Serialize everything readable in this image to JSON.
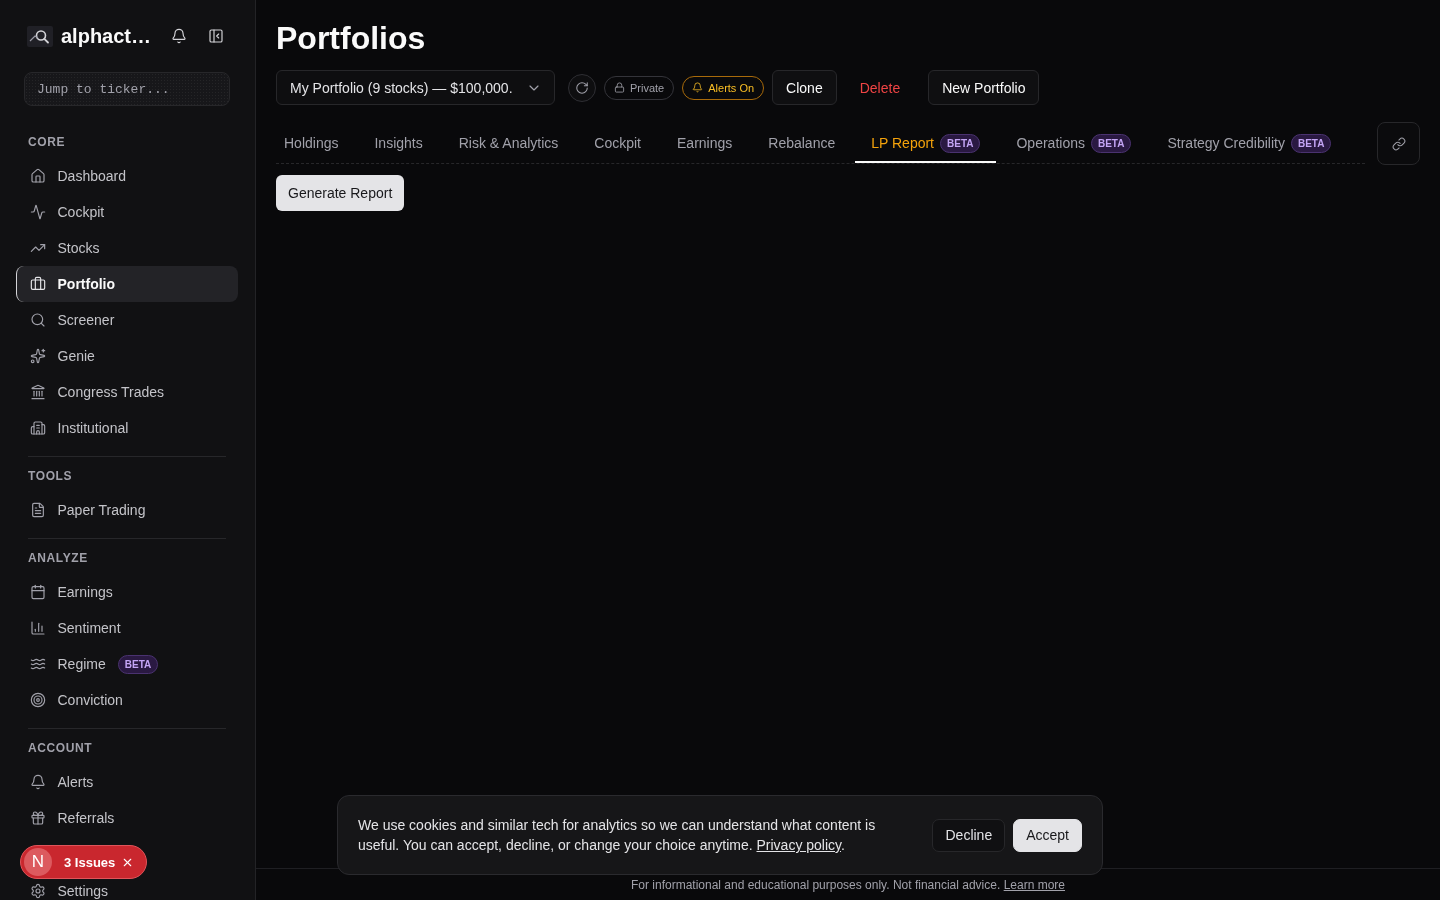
{
  "sidebar": {
    "brand": "alphact…",
    "search": {
      "placeholder": "Jump to ticker..."
    },
    "sections": [
      {
        "title": "CORE",
        "items": [
          {
            "label": "Dashboard",
            "selected": false
          },
          {
            "label": "Cockpit",
            "selected": false
          },
          {
            "label": "Stocks",
            "selected": false
          },
          {
            "label": "Portfolio",
            "selected": true
          },
          {
            "label": "Screener",
            "selected": false
          },
          {
            "label": "Genie",
            "selected": false
          },
          {
            "label": "Congress Trades",
            "selected": false
          },
          {
            "label": "Institutional",
            "selected": false
          }
        ]
      },
      {
        "title": "TOOLS",
        "items": [
          {
            "label": "Paper Trading",
            "selected": false
          }
        ]
      },
      {
        "title": "ANALYZE",
        "items": [
          {
            "label": "Earnings",
            "selected": false
          },
          {
            "label": "Sentiment",
            "selected": false
          },
          {
            "label": "Regime",
            "badge": "BETA",
            "selected": false
          },
          {
            "label": "Conviction",
            "selected": false
          }
        ]
      },
      {
        "title": "ACCOUNT",
        "items": [
          {
            "label": "Alerts",
            "selected": false
          },
          {
            "label": "Referrals",
            "selected": false
          },
          {
            "label": "Settings",
            "selected": false
          }
        ]
      }
    ]
  },
  "issues_toast": {
    "logo": "N",
    "label": "3 Issues"
  },
  "page_title": "Portfolios",
  "toolbar": {
    "portfolio_select": {
      "value": "My Portfolio (9 stocks) — $100,000."
    },
    "visibility": {
      "label": "Private"
    },
    "alerts": {
      "label": "Alerts On",
      "on": true
    },
    "buttons": [
      {
        "label": "Clone",
        "kind": "outline"
      },
      {
        "label": "Delete",
        "kind": "danger"
      },
      {
        "label": "New Portfolio",
        "kind": "outline"
      }
    ]
  },
  "tabs": [
    {
      "label": "Holdings",
      "selected": false
    },
    {
      "label": "Insights",
      "selected": false
    },
    {
      "label": "Risk & Analytics",
      "selected": false
    },
    {
      "label": "Cockpit",
      "selected": false
    },
    {
      "label": "Earnings",
      "selected": false
    },
    {
      "label": "Rebalance",
      "selected": false
    },
    {
      "label": "LP Report",
      "badge": "BETA",
      "selected": true
    },
    {
      "label": "Operations",
      "badge": "BETA",
      "selected": false
    },
    {
      "label": "Strategy Credibility",
      "badge": "BETA",
      "selected": false
    }
  ],
  "generate_button": "Generate Report",
  "cookie_banner": {
    "text": "We use cookies and similar tech for analytics so we can understand what content is useful. You can accept, decline, or change your choice anytime.",
    "link": "Privacy policy",
    "suffix": ".",
    "buttons": [
      {
        "label": "Decline",
        "kind": "secondary"
      },
      {
        "label": "Accept",
        "kind": "primary"
      }
    ]
  },
  "footer": {
    "text": "For informational and educational purposes only. Not financial advice.",
    "link": "Learn more"
  }
}
